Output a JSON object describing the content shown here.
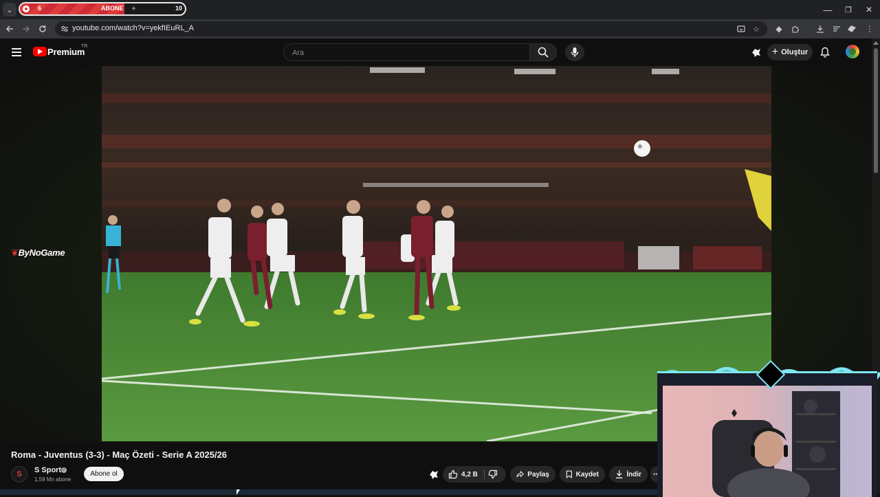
{
  "browser": {
    "tab_group": {
      "count_left": "6",
      "label": "ABONE",
      "count_right": "10"
    },
    "url": "youtube.com/watch?v=yekfIEuRL_A",
    "window_controls": {
      "minimize": "—",
      "maximize": "❐",
      "close": "✕"
    }
  },
  "youtube": {
    "brand": "Premium",
    "region": "TR",
    "search_placeholder": "Ara",
    "create_label": "Oluştur"
  },
  "player": {
    "left_watermark": "ByNoGame"
  },
  "video": {
    "title": "Roma - Juventus (3-3) - Maç Özeti - Serie A 2025/26",
    "channel": {
      "name": "S Sport",
      "subscribers": "1,59 Mn abone",
      "avatar_letter": "S"
    },
    "subscribe_label": "Abone ol",
    "actions": {
      "likes": "4,2 B",
      "share": "Paylaş",
      "save": "Kaydet",
      "download": "İndir"
    }
  },
  "colors": {
    "yt_red": "#ff0000",
    "tab_group_red": "#e03c3c",
    "webcam_accent": "#7ee7f3",
    "pitch_green": "#4f8f3a"
  }
}
